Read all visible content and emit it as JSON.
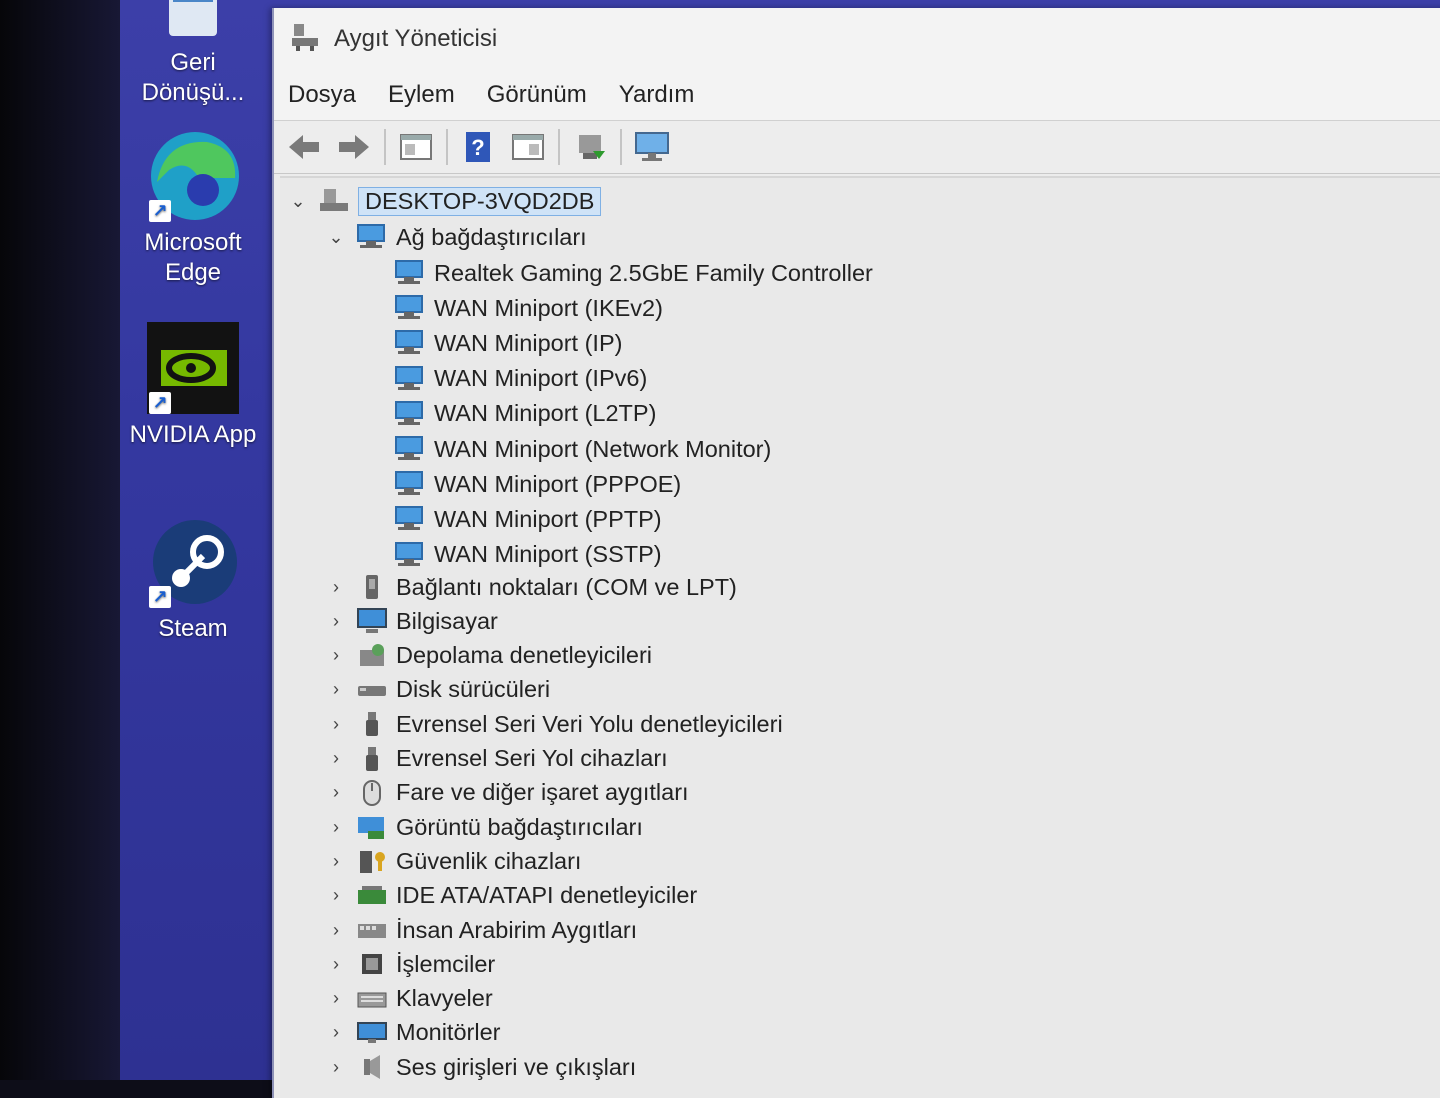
{
  "desktop": {
    "icons": [
      {
        "label": "Geri Dönüşü...",
        "icon": "recycle-bin-icon"
      },
      {
        "label": "Microsoft Edge",
        "icon": "edge-icon"
      },
      {
        "label": "NVIDIA App",
        "icon": "nvidia-icon"
      },
      {
        "label": "Steam",
        "icon": "steam-icon"
      }
    ]
  },
  "window": {
    "title": "Aygıt Yöneticisi",
    "menu": [
      "Dosya",
      "Eylem",
      "Görünüm",
      "Yardım"
    ],
    "toolbar": [
      "back-arrow-icon",
      "forward-arrow-icon",
      "properties-console-icon",
      "help-icon",
      "update-driver-icon",
      "scan-hardware-icon",
      "monitor-icon"
    ]
  },
  "tree": {
    "root": "DESKTOP-3VQD2DB",
    "expanded_category": "Ağ bağdaştırıcıları",
    "network_adapters": [
      "Realtek Gaming 2.5GbE Family Controller",
      "WAN Miniport (IKEv2)",
      "WAN Miniport (IP)",
      "WAN Miniport (IPv6)",
      "WAN Miniport (L2TP)",
      "WAN Miniport (Network Monitor)",
      "WAN Miniport (PPPOE)",
      "WAN Miniport (PPTP)",
      "WAN Miniport (SSTP)"
    ],
    "categories": [
      {
        "label": "Bağlantı noktaları (COM ve LPT)",
        "icon": "port-icon"
      },
      {
        "label": "Bilgisayar",
        "icon": "computer-icon"
      },
      {
        "label": "Depolama denetleyicileri",
        "icon": "storage-controller-icon"
      },
      {
        "label": "Disk sürücüleri",
        "icon": "disk-drive-icon"
      },
      {
        "label": "Evrensel Seri Veri Yolu denetleyicileri",
        "icon": "usb-controller-icon"
      },
      {
        "label": "Evrensel Seri Yol cihazları",
        "icon": "usb-device-icon"
      },
      {
        "label": "Fare ve diğer işaret aygıtları",
        "icon": "mouse-icon"
      },
      {
        "label": "Görüntü bağdaştırıcıları",
        "icon": "display-adapter-icon"
      },
      {
        "label": "Güvenlik cihazları",
        "icon": "security-device-icon"
      },
      {
        "label": "IDE ATA/ATAPI denetleyiciler",
        "icon": "ide-controller-icon"
      },
      {
        "label": "İnsan Arabirim Aygıtları",
        "icon": "hid-icon"
      },
      {
        "label": "İşlemciler",
        "icon": "processor-icon"
      },
      {
        "label": "Klavyeler",
        "icon": "keyboard-icon"
      },
      {
        "label": "Monitörler",
        "icon": "monitor-icon"
      },
      {
        "label": "Ses girişleri ve çıkışları",
        "icon": "audio-io-icon"
      }
    ]
  }
}
